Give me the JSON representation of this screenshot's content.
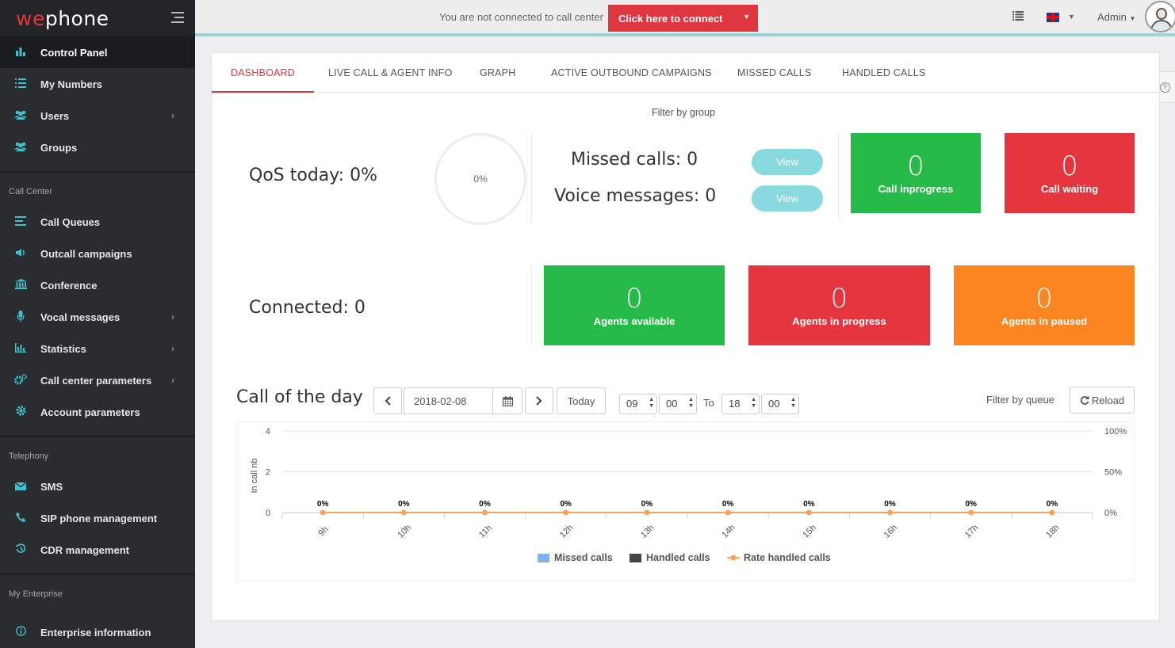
{
  "app": {
    "logo": "wephone",
    "logo_accent": "we",
    "logo_rest": "phone"
  },
  "sidebar": {
    "items": [
      {
        "label": "Control Panel",
        "icon": "bar-chart-icon",
        "active": true
      },
      {
        "label": "My Numbers",
        "icon": "list-icon"
      },
      {
        "label": "Users",
        "icon": "users-icon",
        "submenu": true
      },
      {
        "label": "Groups",
        "icon": "groups-icon"
      }
    ],
    "call_center_title": "Call Center",
    "call_center_items": [
      {
        "label": "Call Queues",
        "icon": "queue-icon"
      },
      {
        "label": "Outcall campaigns",
        "icon": "volume-icon"
      },
      {
        "label": "Conference",
        "icon": "bank-icon"
      },
      {
        "label": "Vocal messages",
        "icon": "microphone-icon",
        "submenu": true
      },
      {
        "label": "Statistics",
        "icon": "statistics-icon",
        "submenu": true
      },
      {
        "label": "Call center parameters",
        "icon": "cogs-icon",
        "submenu": true
      },
      {
        "label": "Account parameters",
        "icon": "gear-icon"
      }
    ],
    "telephony_title": "Telephony",
    "telephony_items": [
      {
        "label": "SMS",
        "icon": "envelope-icon"
      },
      {
        "label": "SIP phone management",
        "icon": "phone-icon"
      },
      {
        "label": "CDR management",
        "icon": "history-icon"
      }
    ],
    "enterprise_title": "My Enterprise",
    "enterprise_items": [
      {
        "label": "Enterprise information",
        "icon": "info-icon"
      }
    ]
  },
  "topbar": {
    "not_connected_text": "You are not connected to call center",
    "connect_button": "Click here to connect",
    "user": "Admin"
  },
  "tabs": [
    "DASHBOARD",
    "LIVE CALL & AGENT INFO",
    "GRAPH",
    "ACTIVE OUTBOUND CAMPAIGNS",
    "MISSED CALLS",
    "HANDLED CALLS"
  ],
  "dashboard": {
    "filter_group": "Filter by group",
    "qos_label": "QoS today: 0%",
    "qos_circle": "0%",
    "missed_calls": "Missed calls: 0",
    "voice_messages": "Voice messages: 0",
    "view_label": "View",
    "connected": "Connected: 0",
    "stats": {
      "call_inprogress": {
        "value": "0",
        "label": "Call inprogress"
      },
      "call_waiting": {
        "value": "0",
        "label": "Call waiting"
      },
      "agents_available": {
        "value": "0",
        "label": "Agents available"
      },
      "agents_in_progress": {
        "value": "0",
        "label": "Agents in progress"
      },
      "agents_paused": {
        "value": "0",
        "label": "Agents in paused"
      }
    }
  },
  "call_of_day": {
    "title": "Call of the day",
    "date": "2018-02-08",
    "today_button": "Today",
    "from_hour": "09",
    "from_min": "00",
    "to_label": "To",
    "to_hour": "18",
    "to_min": "00",
    "filter_queue": "Filter by queue",
    "reload_button": "Reload"
  },
  "chart_data": {
    "type": "bar",
    "categories": [
      "9h",
      "10h",
      "11h",
      "12h",
      "13h",
      "14h",
      "15h",
      "16h",
      "17h",
      "18h"
    ],
    "ylabel": "In call nb",
    "y_ticks": [
      "4",
      "2",
      "0"
    ],
    "ylim": [
      0,
      4
    ],
    "y2_ticks": [
      "100%",
      "50%",
      "0%"
    ],
    "y2lim": [
      0,
      100
    ],
    "series": [
      {
        "name": "Missed calls",
        "type": "bar",
        "values": [
          0,
          0,
          0,
          0,
          0,
          0,
          0,
          0,
          0,
          0
        ],
        "color": "#7cb5ec"
      },
      {
        "name": "Handled calls",
        "type": "bar",
        "values": [
          0,
          0,
          0,
          0,
          0,
          0,
          0,
          0,
          0,
          0
        ],
        "color": "#434348"
      },
      {
        "name": "Rate handled calls",
        "type": "line",
        "values": [
          0,
          0,
          0,
          0,
          0,
          0,
          0,
          0,
          0,
          0
        ],
        "color": "#f7a35c"
      }
    ],
    "data_labels": [
      "0%",
      "0%",
      "0%",
      "0%",
      "0%",
      "0%",
      "0%",
      "0%",
      "0%",
      "0%"
    ],
    "grid": true,
    "legend": "bottom-center"
  },
  "colors": {
    "accent": "#e0363f",
    "green": "#26bb48",
    "red": "#e5363f",
    "orange": "#fb8521",
    "teal": "#88dade",
    "sidebar": "#2a2c30"
  }
}
